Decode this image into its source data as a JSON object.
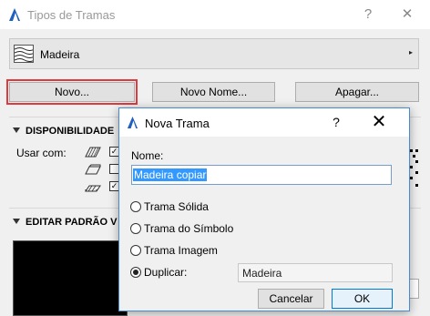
{
  "window": {
    "title": "Tipos de Tramas",
    "help_glyph": "?",
    "close_glyph": "✕"
  },
  "pattern_selector": {
    "name": "Madeira",
    "arrow_glyph": "▸"
  },
  "actions": {
    "new_label": "Novo...",
    "new_name_label": "Novo Nome...",
    "delete_label": "Apagar..."
  },
  "sections": {
    "availability": "DISPONIBILIDADE",
    "edit_pattern": "EDITAR PADRÃO V"
  },
  "availability": {
    "use_with_label": "Usar com:",
    "options": [
      {
        "icon": "hatch-diagonal-icon",
        "checked": true
      },
      {
        "icon": "hatch-box-icon",
        "checked": false
      },
      {
        "icon": "hatch-slab-icon",
        "checked": true
      }
    ]
  },
  "dialog": {
    "title": "Nova Trama",
    "help_glyph": "?",
    "close_glyph": "✕",
    "name_label": "Nome:",
    "name_value": "Madeira copiar",
    "options": [
      {
        "label": "Trama Sólida",
        "selected": false
      },
      {
        "label": "Trama do Símbolo",
        "selected": false
      },
      {
        "label": "Trama Imagem",
        "selected": false
      },
      {
        "label": "Duplicar:",
        "selected": true
      }
    ],
    "duplicate_value": "Madeira",
    "cancel_label": "Cancelar",
    "ok_label": "OK"
  },
  "colors": {
    "accent": "#0078d7",
    "focus_ring": "#e0393e",
    "selection": "#3399ff"
  }
}
